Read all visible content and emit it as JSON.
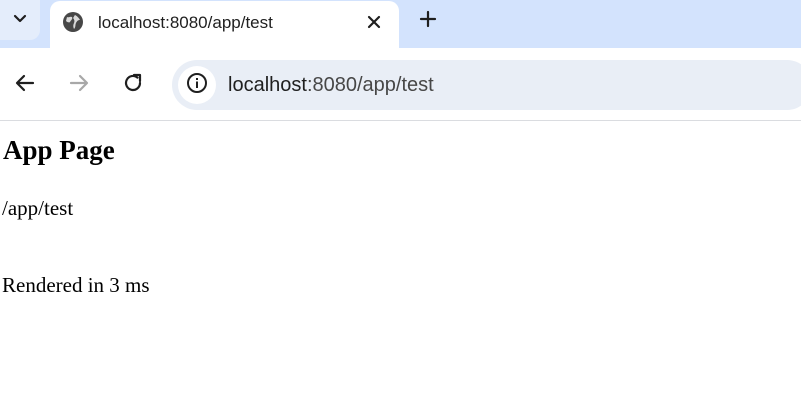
{
  "tab": {
    "title": "localhost:8080/app/test"
  },
  "omnibox": {
    "host": "localhost",
    "rest": ":8080/app/test"
  },
  "page": {
    "heading": "App Page",
    "path": "/app/test",
    "rendered": "Rendered in 3 ms"
  },
  "icons": {
    "tab_search": "chevron-down-icon",
    "favicon": "globe-icon",
    "close": "close-icon",
    "new_tab": "plus-icon",
    "back": "back-arrow-icon",
    "forward": "forward-arrow-icon",
    "reload": "reload-icon",
    "site_info": "info-icon"
  },
  "colors": {
    "tabstrip": "#d3e3fd",
    "omnibox": "#e9eef6",
    "forward_disabled": "#a8a8a8"
  }
}
